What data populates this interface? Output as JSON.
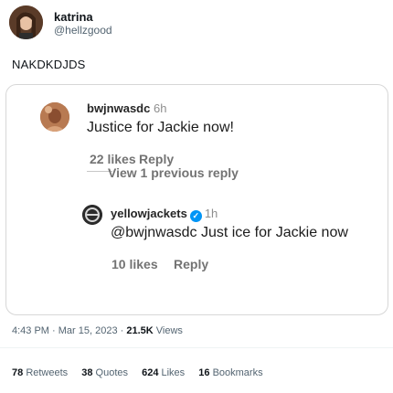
{
  "tweet": {
    "author_name": "katrina",
    "author_handle": "@hellzgood",
    "text": "NAKDKDJDS",
    "timestamp": "4:43 PM · Mar 15, 2023 · ",
    "views_count": "21.5K",
    "views_label": "Views"
  },
  "embedded": {
    "comment1": {
      "username": "bwjnwasdc",
      "time": "6h",
      "text": "Justice for Jackie now!",
      "likes": "22 likes",
      "reply": "Reply"
    },
    "view_previous": "View 1 previous reply",
    "comment2": {
      "username": "yellowjackets",
      "verified_icon": "✓",
      "time": "1h",
      "text": "@bwjnwasdc Just ice for Jackie now",
      "likes": "10 likes",
      "reply": "Reply"
    }
  },
  "stats": {
    "retweets_count": "78",
    "retweets_label": "Retweets",
    "quotes_count": "38",
    "quotes_label": "Quotes",
    "likes_count": "624",
    "likes_label": "Likes",
    "bookmarks_count": "16",
    "bookmarks_label": "Bookmarks"
  },
  "colors": {
    "text_primary": "#0f1419",
    "text_secondary": "#536471",
    "verified_blue": "#0095f6"
  }
}
